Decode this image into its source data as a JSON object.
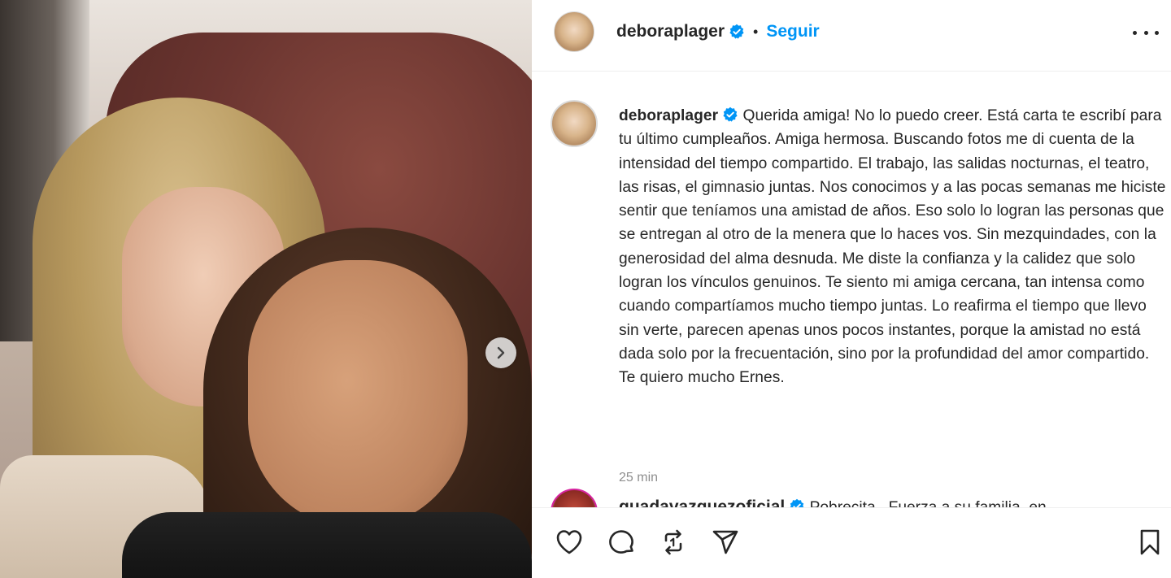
{
  "post": {
    "username": "deboraplager",
    "follow_label": "Seguir",
    "separator": "•"
  },
  "caption": {
    "username": "deboraplager",
    "text": "Querida amiga! No lo puedo creer. Está carta te escribí para tu último cumpleaños. Amiga hermosa. Buscando fotos me di cuenta de la intensidad del tiempo compartido. El trabajo, las salidas nocturnas, el teatro, las risas, el gimnasio juntas. Nos conocimos y a las pocas semanas me hiciste sentir que teníamos una amistad de años. Eso solo lo logran las personas que se entregan al otro de la menera que lo haces vos. Sin mezquindades, con la generosidad del alma desnuda. Me diste la confianza y la calidez que solo logran los vínculos genuinos. Te siento mi amiga cercana, tan intensa como cuando compartíamos mucho tiempo juntas. Lo reafirma el tiempo que llevo sin verte, parecen apenas unos pocos instantes, porque la amistad no está dada solo por la frecuentación, sino por la profundidad del amor compartido. Te quiero mucho Ernes.",
    "timestamp": "25 min"
  },
  "comment": {
    "username": "guadavazquezoficial",
    "text": "Pobrecita.. Fuerza a su familia, en"
  },
  "icons": {
    "verified": "verified-badge-icon",
    "more": "more-options-icon",
    "next": "chevron-right-icon",
    "like": "heart-icon",
    "comment": "comment-bubble-icon",
    "repost": "repost-icon",
    "share": "paper-plane-icon",
    "save": "bookmark-icon"
  },
  "colors": {
    "accent": "#0095f6",
    "text": "#262626",
    "muted": "#8e8e8e"
  }
}
